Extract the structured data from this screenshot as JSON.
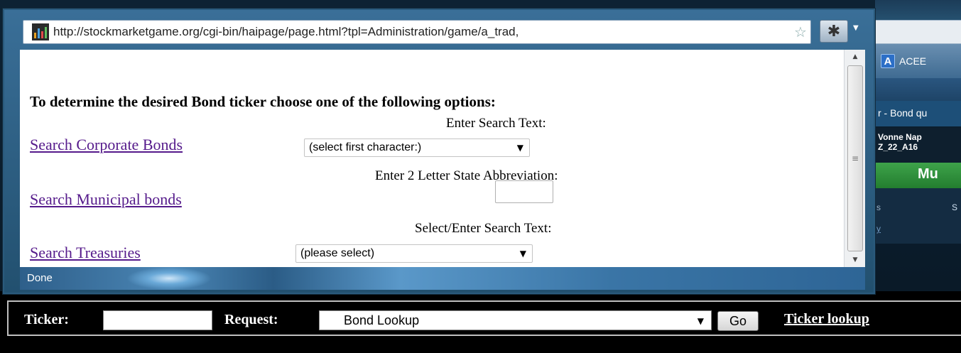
{
  "popup": {
    "url": "http://stockmarketgame.org/cgi-bin/haipage/page.html?tpl=Administration/game/a_trad,",
    "status": "Done"
  },
  "form": {
    "heading": "To determine the desired Bond ticker choose one of the following options:",
    "corporate": {
      "label": "Enter Search Text:",
      "link": "Search Corporate Bonds",
      "select_value": "(select first character:)"
    },
    "municipal": {
      "label": "Enter 2 Letter State Abbreviation:",
      "link": "Search Municipal bonds",
      "input_value": ""
    },
    "treasuries": {
      "label": "Select/Enter Search Text:",
      "link": "Search Treasuries",
      "select_value": "(please select)"
    }
  },
  "background_window": {
    "bookmark_label": "ACEE",
    "tab_title": "r - Bond qu",
    "user_line1": "Vonne Nap",
    "user_line2": "Z_22_A16",
    "green_label": "Mu",
    "row_a": "s",
    "row_b": "S",
    "row_c": "y"
  },
  "ticker_bar": {
    "ticker_label": "Ticker:",
    "ticker_value": "",
    "request_label": "Request:",
    "request_value": "Bond Lookup",
    "go_label": "Go",
    "lookup_link": "Ticker lookup"
  },
  "colors": {
    "visited_link": "#551a8b",
    "popup_frame": "#2a5a7c",
    "status_bar": "#3a75a6"
  },
  "icons": {
    "site": "bar-chart-favicon",
    "bookmark": "star-icon",
    "addon": "asterisk-icon",
    "dropdown": "chevron-down-icon"
  }
}
